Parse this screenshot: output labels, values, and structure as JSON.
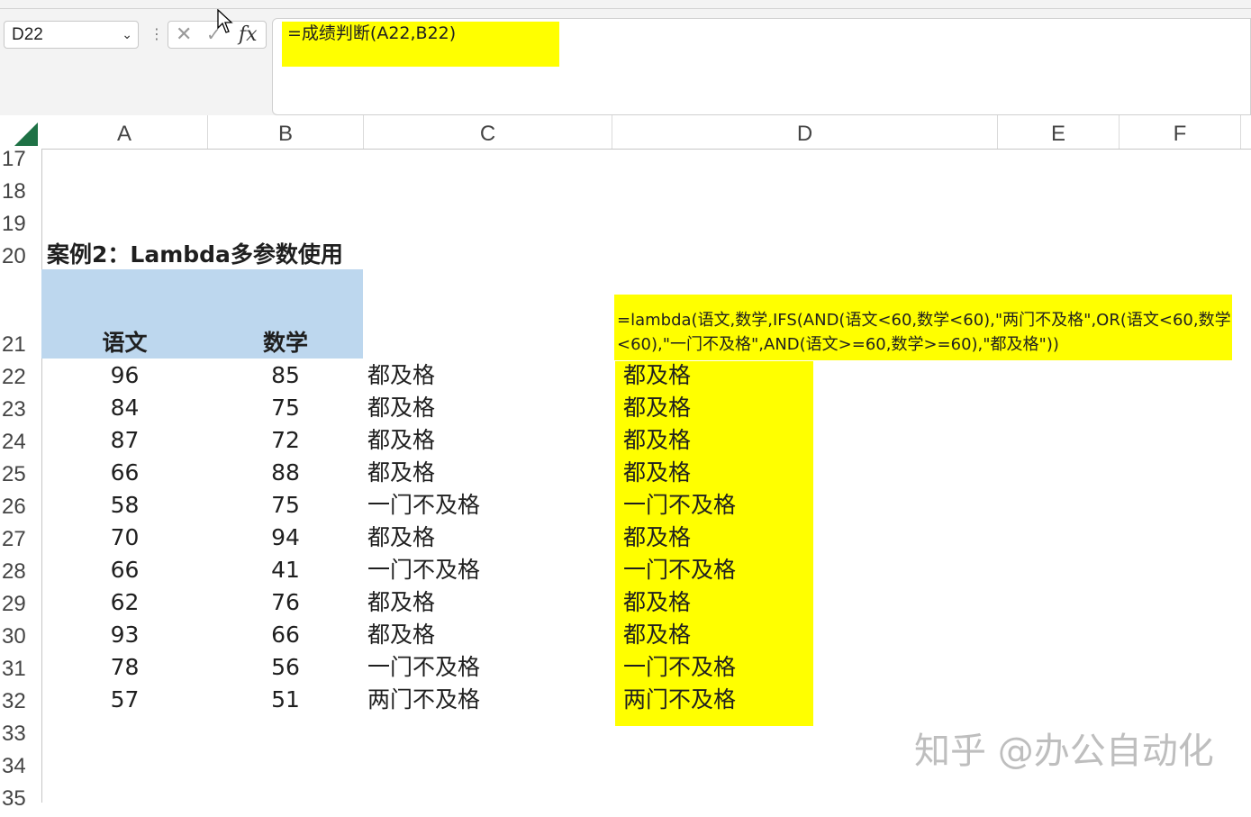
{
  "name_box": {
    "value": "D22"
  },
  "formula_bar": {
    "formula": "=成绩判断(A22,B22)",
    "fx_label": "fx",
    "cancel_icon": "✕",
    "enter_icon": "✓"
  },
  "columns": [
    "A",
    "B",
    "C",
    "D",
    "E",
    "F"
  ],
  "rows": [
    "17",
    "18",
    "19",
    "20",
    "21",
    "22",
    "23",
    "24",
    "25",
    "26",
    "27",
    "28",
    "29",
    "30",
    "31",
    "32",
    "33",
    "34",
    "35"
  ],
  "sheet": {
    "case_title": "案例2：Lambda多参数使用",
    "header_a": "语文",
    "header_b": "数学",
    "formula_note": "=lambda(语文,数学,IFS(AND(语文<60,数学<60),\"两门不及格\",OR(语文<60,数学<60),\"一门不及格\",AND(语文>=60,数学>=60),\"都及格\"))",
    "data": [
      {
        "a": "96",
        "b": "85",
        "c": "都及格",
        "d": "都及格"
      },
      {
        "a": "84",
        "b": "75",
        "c": "都及格",
        "d": "都及格"
      },
      {
        "a": "87",
        "b": "72",
        "c": "都及格",
        "d": "都及格"
      },
      {
        "a": "66",
        "b": "88",
        "c": "都及格",
        "d": "都及格"
      },
      {
        "a": "58",
        "b": "75",
        "c": "一门不及格",
        "d": "一门不及格"
      },
      {
        "a": "70",
        "b": "94",
        "c": "都及格",
        "d": "都及格"
      },
      {
        "a": "66",
        "b": "41",
        "c": "一门不及格",
        "d": "一门不及格"
      },
      {
        "a": "62",
        "b": "76",
        "c": "都及格",
        "d": "都及格"
      },
      {
        "a": "93",
        "b": "66",
        "c": "都及格",
        "d": "都及格"
      },
      {
        "a": "78",
        "b": "56",
        "c": "一门不及格",
        "d": "一门不及格"
      },
      {
        "a": "57",
        "b": "51",
        "c": "两门不及格",
        "d": "两门不及格"
      }
    ]
  },
  "watermark": "知乎 @办公自动化",
  "colors": {
    "highlight": "#ffff00",
    "header_fill": "#bdd7ee",
    "select_all": "#1e7145"
  }
}
